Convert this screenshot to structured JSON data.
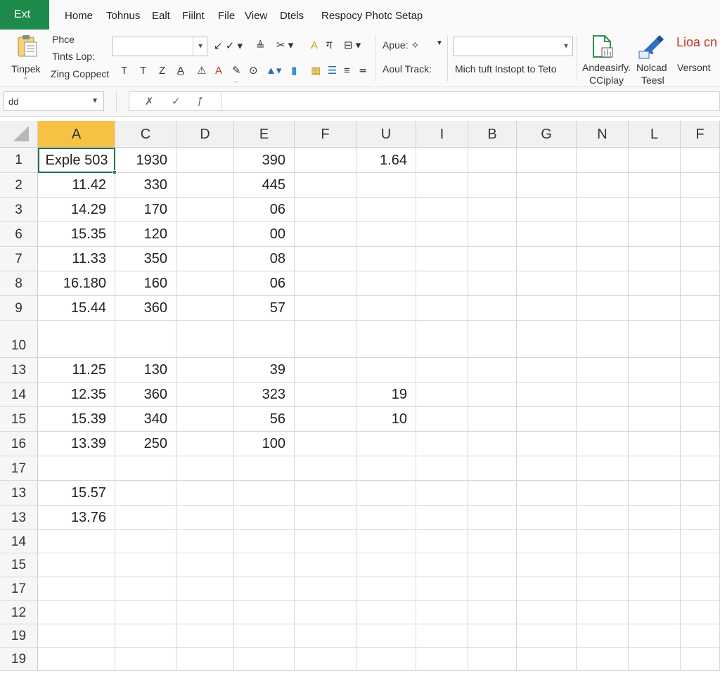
{
  "app": {
    "badge": "Ext"
  },
  "menu": [
    "Home",
    "Tohnus",
    "Ealt",
    "Fiilnt",
    "File",
    "View",
    "Dtels",
    "Respocy Photc Setap"
  ],
  "ribbon": {
    "paste_label": "Tinpek",
    "clipboard_lines": [
      "Phce",
      "Tints Lop:",
      "Zing Coppect"
    ],
    "font_row_glyphs": [
      "T",
      "T",
      "Z",
      "A",
      "⚠",
      "A",
      "✎",
      "⊙",
      "🖌",
      "▼",
      "▮",
      "▦",
      "☰",
      "≡"
    ],
    "align_row_glyphs": [
      "✓",
      "✓",
      "≡",
      "✂",
      "▾",
      "A",
      "ग",
      "⊟",
      "▾"
    ],
    "apue_label": "Apue: ✧",
    "track_label": "Aoul Track:",
    "insert_label": "Mich tuft Instopt to Teto",
    "group1_line1": "Andeasirfy.",
    "group1_line2": "CCiplay",
    "group2_line1": "Nolcad",
    "group2_line2": "Teesl",
    "group3_label": "Versont",
    "corner_label": "Lioa cn"
  },
  "formula_bar": {
    "name_box": "dd",
    "cancel_symbol": "✗",
    "confirm_symbol": "✓",
    "fx_symbol": "ƒ",
    "value": ""
  },
  "sheet": {
    "columns": [
      "A",
      "C",
      "D",
      "E",
      "F",
      "U",
      "I",
      "B",
      "G",
      "N",
      "L",
      "F"
    ],
    "active_column": 0,
    "selected_cell": "A1",
    "rows": [
      {
        "label": "1",
        "cells": [
          "Exple 503",
          "1930",
          "",
          "390",
          "",
          "1.64",
          "",
          "",
          "",
          "",
          "",
          ""
        ]
      },
      {
        "label": "2",
        "cells": [
          "11.42",
          "330",
          "",
          "445",
          "",
          "",
          "",
          "",
          "",
          "",
          "",
          ""
        ]
      },
      {
        "label": "3",
        "cells": [
          "14.29",
          "170",
          "",
          "06",
          "",
          "",
          "",
          "",
          "",
          "",
          "",
          ""
        ]
      },
      {
        "label": "6",
        "cells": [
          "15.35",
          "120",
          "",
          "00",
          "",
          "",
          "",
          "",
          "",
          "",
          "",
          ""
        ]
      },
      {
        "label": "7",
        "cells": [
          "11.33",
          "350",
          "",
          "08",
          "",
          "",
          "",
          "",
          "",
          "",
          "",
          ""
        ]
      },
      {
        "label": "8",
        "cells": [
          "16.180",
          "160",
          "",
          "06",
          "",
          "",
          "",
          "",
          "",
          "",
          "",
          ""
        ]
      },
      {
        "label": "9",
        "cells": [
          "15.44",
          "360",
          "",
          "57",
          "",
          "",
          "",
          "",
          "",
          "",
          "",
          ""
        ]
      },
      {
        "label": "10",
        "cells": [
          "",
          "",
          "",
          "",
          "",
          "",
          "",
          "",
          "",
          "",
          "",
          ""
        ]
      },
      {
        "label": "13",
        "cells": [
          "11.25",
          "130",
          "",
          "39",
          "",
          "",
          "",
          "",
          "",
          "",
          "",
          ""
        ]
      },
      {
        "label": "14",
        "cells": [
          "12.35",
          "360",
          "",
          "323",
          "",
          "19",
          "",
          "",
          "",
          "",
          "",
          ""
        ]
      },
      {
        "label": "15",
        "cells": [
          "15.39",
          "340",
          "",
          "56",
          "",
          "10",
          "",
          "",
          "",
          "",
          "",
          ""
        ]
      },
      {
        "label": "16",
        "cells": [
          "13.39",
          "250",
          "",
          "100",
          "",
          "",
          "",
          "",
          "",
          "",
          "",
          ""
        ]
      },
      {
        "label": "17",
        "cells": [
          "",
          "",
          "",
          "",
          "",
          "",
          "",
          "",
          "",
          "",
          "",
          ""
        ]
      },
      {
        "label": "13",
        "cells": [
          "15.57",
          "",
          "",
          "",
          "",
          "",
          "",
          "",
          "",
          "",
          "",
          ""
        ]
      },
      {
        "label": "13",
        "cells": [
          "13.76",
          "",
          "",
          "",
          "",
          "",
          "",
          "",
          "",
          "",
          "",
          ""
        ]
      },
      {
        "label": "14",
        "cells": [
          "",
          "",
          "",
          "",
          "",
          "",
          "",
          "",
          "",
          "",
          "",
          ""
        ]
      },
      {
        "label": "15",
        "cells": [
          "",
          "",
          "",
          "",
          "",
          "",
          "",
          "",
          "",
          "",
          "",
          ""
        ]
      },
      {
        "label": "17",
        "cells": [
          "",
          "",
          "",
          "",
          "",
          "",
          "",
          "",
          "",
          "",
          "",
          ""
        ]
      },
      {
        "label": "12",
        "cells": [
          "",
          "",
          "",
          "",
          "",
          "",
          "",
          "",
          "",
          "",
          "",
          ""
        ]
      },
      {
        "label": "19",
        "cells": [
          "",
          "",
          "",
          "",
          "",
          "",
          "",
          "",
          "",
          "",
          "",
          ""
        ]
      },
      {
        "label": "19",
        "cells": [
          "",
          "",
          "",
          "",
          "",
          "",
          "",
          "",
          "",
          "",
          "",
          ""
        ]
      }
    ]
  },
  "colors": {
    "brand": "#1e8b4c",
    "active_column": "#f7c243",
    "selection": "#217346",
    "accent_red": "#c0392b"
  }
}
